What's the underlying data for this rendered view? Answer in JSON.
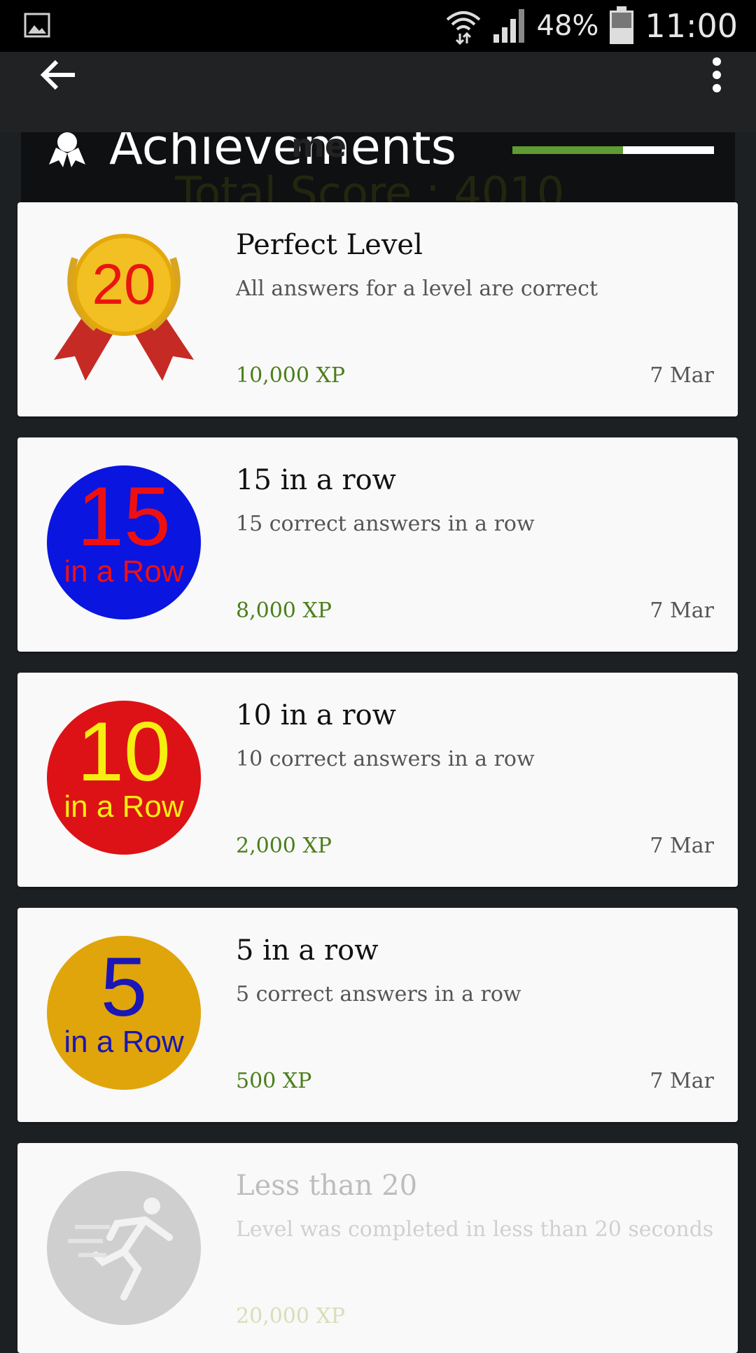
{
  "status_bar": {
    "battery": "48%",
    "time": "11:00"
  },
  "toolbar": {
    "back_icon": "arrow-back-icon",
    "menu_icon": "overflow-menu-icon"
  },
  "background": {
    "title": "Achievements",
    "subtitle": "me",
    "score": "Total Score : 4010",
    "progress_fraction": 0.55
  },
  "achievements": [
    {
      "title": "Perfect Level",
      "description": "All answers for a level are correct",
      "xp": "10,000 XP",
      "date": "7 Mar",
      "badge": {
        "num": "20",
        "sub": "",
        "bg": "#f3c023",
        "num_color": "#e8160f",
        "sub_color": ""
      }
    },
    {
      "title": "15 in a row",
      "description": "15 correct answers in a row",
      "xp": "8,000 XP",
      "date": "7 Mar",
      "badge": {
        "num": "15",
        "sub": "in a Row",
        "bg": "#0b15e0",
        "num_color": "#ee1010",
        "sub_color": "#ee1010"
      }
    },
    {
      "title": "10 in a row",
      "description": "10 correct answers in a row",
      "xp": "2,000 XP",
      "date": "7 Mar",
      "badge": {
        "num": "10",
        "sub": "in a Row",
        "bg": "#dd1216",
        "num_color": "#f6ee10",
        "sub_color": "#f6ee10"
      }
    },
    {
      "title": "5 in a row",
      "description": "5 correct answers in a row",
      "xp": "500 XP",
      "date": "7 Mar",
      "badge": {
        "num": "5",
        "sub": "in a Row",
        "bg": "#e0a50b",
        "num_color": "#1b16b5",
        "sub_color": "#1b16b5"
      }
    },
    {
      "title": "Less than 20",
      "description": "Level was completed in less than 20 seconds",
      "xp": "20,000 XP",
      "date": "",
      "badge": {
        "num": "",
        "sub": "",
        "bg": "#cfcfcf",
        "num_color": "",
        "sub_color": ""
      }
    }
  ]
}
